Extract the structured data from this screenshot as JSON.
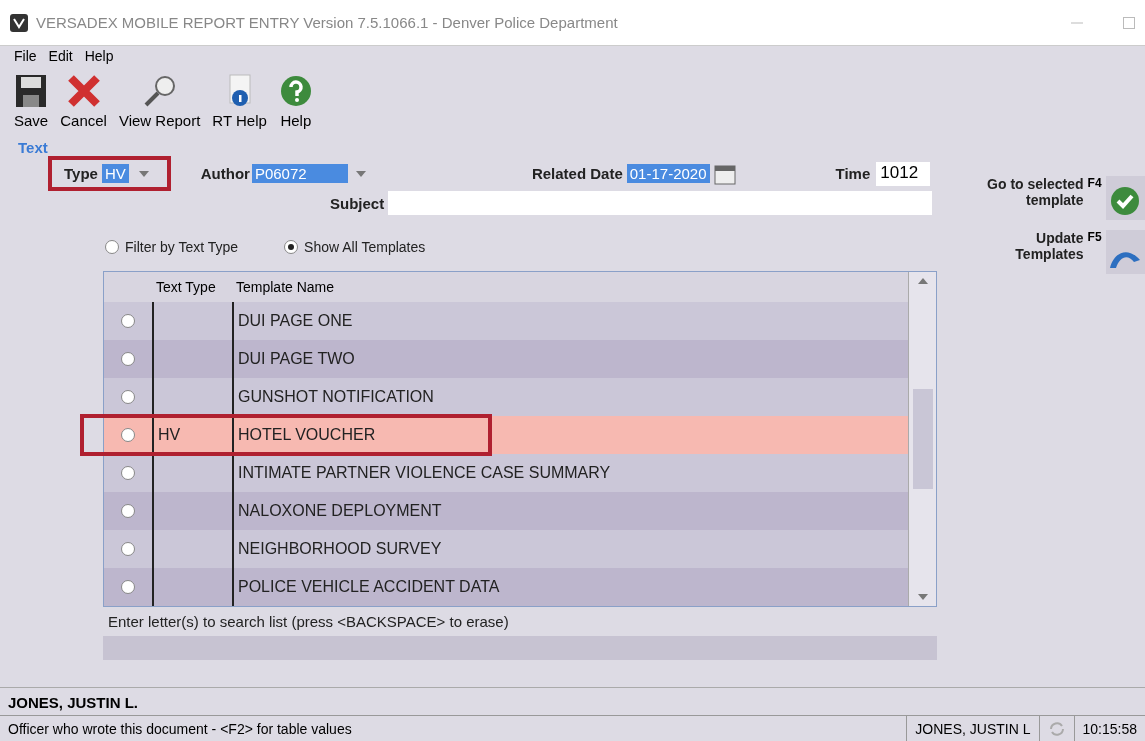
{
  "window": {
    "title": "VERSADEX MOBILE REPORT ENTRY Version 7.5.1066.1 - Denver Police Department"
  },
  "menu": [
    "File",
    "Edit",
    "Help"
  ],
  "toolbar": [
    {
      "label": "Save",
      "kind": "save"
    },
    {
      "label": "Cancel",
      "kind": "cancel"
    },
    {
      "label": "View Report",
      "kind": "view"
    },
    {
      "label": "RT Help",
      "kind": "info"
    },
    {
      "label": "Help",
      "kind": "help"
    }
  ],
  "section_label": "Text",
  "form": {
    "type": {
      "label": "Type",
      "value": "HV",
      "highlighted": true
    },
    "author": {
      "label": "Author",
      "value": "P06072"
    },
    "related_date": {
      "label": "Related Date",
      "value": "01-17-2020"
    },
    "time": {
      "label": "Time",
      "value": "1012"
    },
    "subject": {
      "label": "Subject"
    }
  },
  "side_buttons": [
    {
      "label": "Go to selected template",
      "key": "F4",
      "kind": "check"
    },
    {
      "label": "Update Templates",
      "key": "F5",
      "kind": "update"
    }
  ],
  "filter_options": [
    {
      "label": "Filter by Text Type",
      "selected": false
    },
    {
      "label": "Show All Templates",
      "selected": true
    }
  ],
  "table": {
    "columns": [
      "Text Type",
      "Template Name"
    ],
    "rows": [
      {
        "text_type": "",
        "name": "DUI PAGE ONE",
        "selected": false,
        "highlighted": false
      },
      {
        "text_type": "",
        "name": "DUI PAGE TWO",
        "selected": false,
        "highlighted": false
      },
      {
        "text_type": "",
        "name": "GUNSHOT NOTIFICATION",
        "selected": false,
        "highlighted": false
      },
      {
        "text_type": "HV",
        "name": "HOTEL VOUCHER",
        "selected": true,
        "highlighted": true
      },
      {
        "text_type": "",
        "name": "INTIMATE PARTNER VIOLENCE CASE SUMMARY",
        "selected": false,
        "highlighted": false
      },
      {
        "text_type": "",
        "name": "NALOXONE DEPLOYMENT",
        "selected": false,
        "highlighted": false
      },
      {
        "text_type": "",
        "name": "NEIGHBORHOOD SURVEY",
        "selected": false,
        "highlighted": false
      },
      {
        "text_type": "",
        "name": "POLICE VEHICLE ACCIDENT DATA",
        "selected": false,
        "highlighted": false
      }
    ]
  },
  "search_hint": "Enter letter(s) to search list (press <BACKSPACE> to erase)",
  "officer_name": "JONES, JUSTIN L.",
  "status_bar": {
    "message": "Officer who wrote this document - <F2> for table values",
    "user": "JONES, JUSTIN L",
    "time": "10:15:58"
  }
}
